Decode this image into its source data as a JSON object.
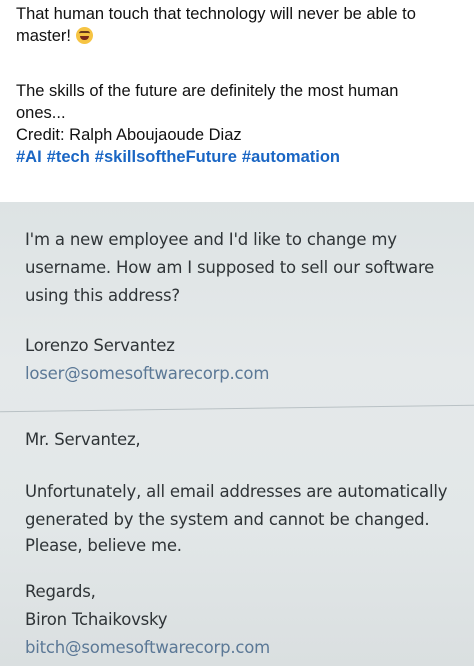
{
  "post": {
    "line1": "That human touch that technology will never be able to",
    "line2": "master!",
    "emoji": "rolling-on-floor-laughing-emoji",
    "line3": "The skills of the future are definitely the most human",
    "line4": "ones...",
    "credit": "Credit: Ralph Aboujaoude Diaz",
    "hashtags": [
      "#AI",
      "#tech",
      "#skillsoftheFuture",
      "#automation"
    ]
  },
  "photo": {
    "request": {
      "line1": "I'm a new employee and I'd like to change my",
      "line2": "username. How am I supposed to sell our software",
      "line3": "using this address?",
      "sender_name": "Lorenzo Servantez",
      "sender_email": "loser@somesoftwarecorp.com"
    },
    "reply": {
      "greeting": "Mr. Servantez,",
      "line1": "Unfortunately, all email addresses are automatically",
      "line2": "generated by the system and cannot be changed.",
      "line3": "Please, believe me.",
      "closing": "Regards,",
      "sender_name": "Biron Tchaikovsky",
      "sender_email": "bitch@somesoftwarecorp.com"
    }
  }
}
